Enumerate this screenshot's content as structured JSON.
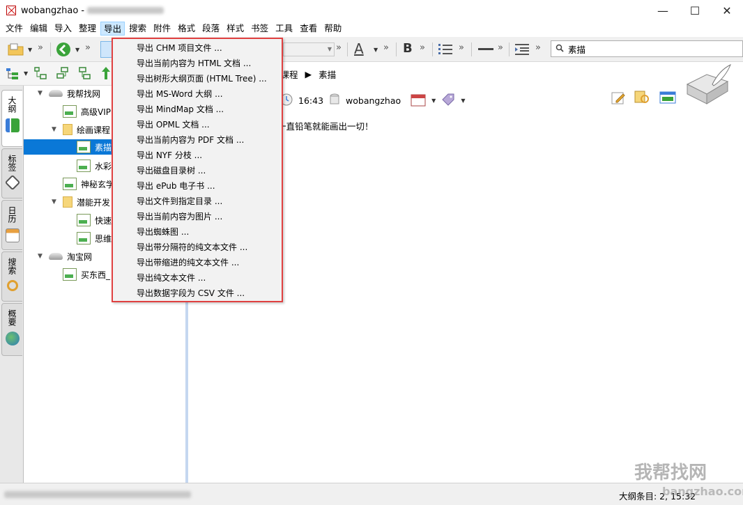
{
  "window": {
    "title": "wobangzhao -",
    "minimize": "—",
    "maximize": "☐",
    "close": "✕"
  },
  "menu": [
    "文件",
    "编辑",
    "导入",
    "整理",
    "导出",
    "搜索",
    "附件",
    "格式",
    "段落",
    "样式",
    "书签",
    "工具",
    "查看",
    "帮助"
  ],
  "active_menu_index": 4,
  "toolbar": {
    "search_value": "素描",
    "bold_label": "B",
    "font_color_label": "A",
    "overflow": "»"
  },
  "sidetabs": [
    "大纲",
    "标签",
    "日历",
    "搜索",
    "概要"
  ],
  "tree": [
    {
      "label": "我帮找网",
      "type": "drive",
      "expanded": true
    },
    {
      "label": "高级VIP",
      "type": "note"
    },
    {
      "label": "绘画课程",
      "type": "folder",
      "expanded": true
    },
    {
      "label": "素描",
      "type": "note",
      "selected": true
    },
    {
      "label": "水彩",
      "type": "note"
    },
    {
      "label": "神秘玄学",
      "type": "note"
    },
    {
      "label": "潜能开发",
      "type": "folder",
      "expanded": true
    },
    {
      "label": "快速",
      "type": "note"
    },
    {
      "label": "思维",
      "type": "note"
    },
    {
      "label": "淘宝网",
      "type": "drive",
      "expanded": true
    },
    {
      "label": "买东西_",
      "type": "note"
    }
  ],
  "breadcrumb": {
    "parent": "画课程",
    "sep": "▶",
    "current": "素描"
  },
  "info": {
    "time": "16:43",
    "user": "wobangzhao"
  },
  "body_text": "一直铅笔就能画出一切！",
  "export_menu": [
    "导出 CHM 项目文件 ...",
    "导出当前内容为 HTML 文档 ...",
    "导出树形大纲页面 (HTML Tree) ...",
    "导出 MS-Word 大纲 ...",
    "导出 MindMap 文档 ...",
    "导出 OPML 文档 ...",
    "导出当前内容为 PDF 文档 ...",
    "导出 NYF 分枝 ...",
    "导出磁盘目录树 ...",
    "导出 ePub 电子书 ...",
    "导出文件到指定目录 ...",
    "导出当前内容为图片 ...",
    "导出蜘蛛图 ...",
    "导出带分隔符的纯文本文件 ...",
    "导出带缩进的纯文本文件 ...",
    "导出纯文本文件 ...",
    "导出数据字段为 CSV 文件 ..."
  ],
  "status": {
    "right": "大纲条目: 2, 15:32"
  },
  "watermark": {
    "main": "我帮找网",
    "sub": "bangzhao.com"
  },
  "colors": {
    "selection": "#0a78d7",
    "menu_highlight": "#cce8ff",
    "dropdown_border": "#e04040"
  }
}
